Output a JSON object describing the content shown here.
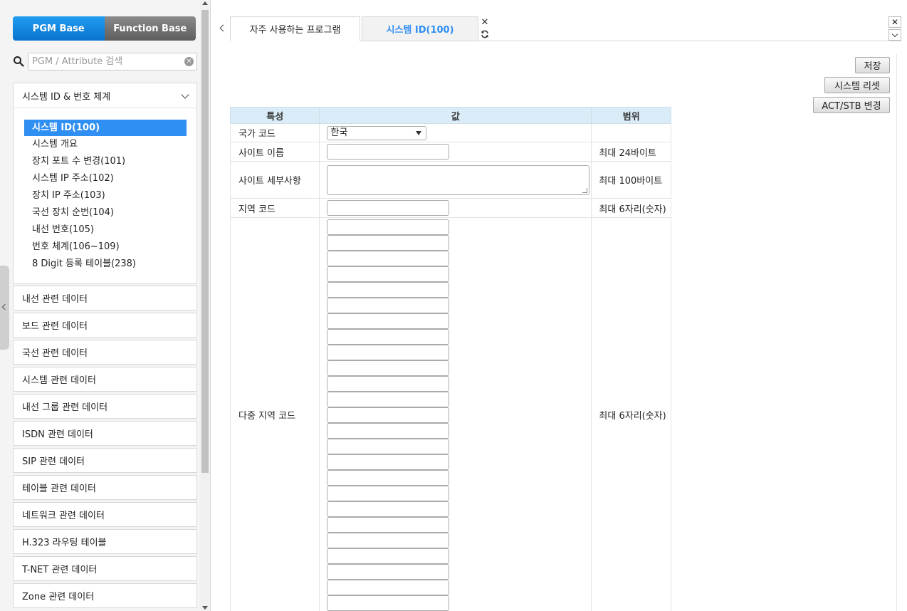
{
  "sidebar": {
    "mode_tabs": [
      "PGM Base",
      "Function Base"
    ],
    "search_placeholder": "PGM / Attribute 검색",
    "open_group": {
      "label": "시스템 ID & 번호 체계",
      "items": [
        "시스템 ID(100)",
        "시스템 개요",
        "장치 포트 수 변경(101)",
        "시스템 IP 주소(102)",
        "장치 IP 주소(103)",
        "국선 장치 순번(104)",
        "내선 번호(105)",
        "번호 체계(106~109)",
        "8 Digit 등록 테이블(238)"
      ],
      "selected_index": 0
    },
    "groups": [
      "내선 관련 데이터",
      "보드 관련 데이터",
      "국선 관련 데이터",
      "시스템 관련 데이터",
      "내선 그룹 관련 데이터",
      "ISDN 관련 데이터",
      "SIP 관련 데이터",
      "테이블 관련 데이터",
      "네트워크 관련 데이터",
      "H.323 라우팅 테이블",
      "T-NET 관련 데이터",
      "Zone 관련 데이터"
    ]
  },
  "tabs": {
    "favorites": "자주 사용하는 프로그램",
    "active": "시스템 ID(100)"
  },
  "actions": {
    "save": "저장",
    "reset": "시스템 리셋",
    "actstb": "ACT/STB 변경"
  },
  "table": {
    "headers": {
      "attr": "특성",
      "value": "값",
      "range": "범위"
    },
    "country": {
      "label": "국가 코드",
      "value": "한국"
    },
    "site_name": {
      "label": "사이트 이름",
      "range": "최대 24바이트"
    },
    "site_detail": {
      "label": "사이트 세부사항",
      "range": "최대 100바이트"
    },
    "area_code": {
      "label": "지역 코드",
      "range": "최대 6자리(숫자)"
    },
    "multi_area": {
      "label": "다중 지역 코드",
      "range": "최대 6자리(숫자)",
      "input_count": 25
    }
  },
  "icons": {
    "search": "search-icon",
    "clear": "clear-icon",
    "chevron": "chevron-down-icon",
    "back": "chevron-left-icon",
    "close": "close-icon",
    "refresh": "refresh-icon"
  }
}
